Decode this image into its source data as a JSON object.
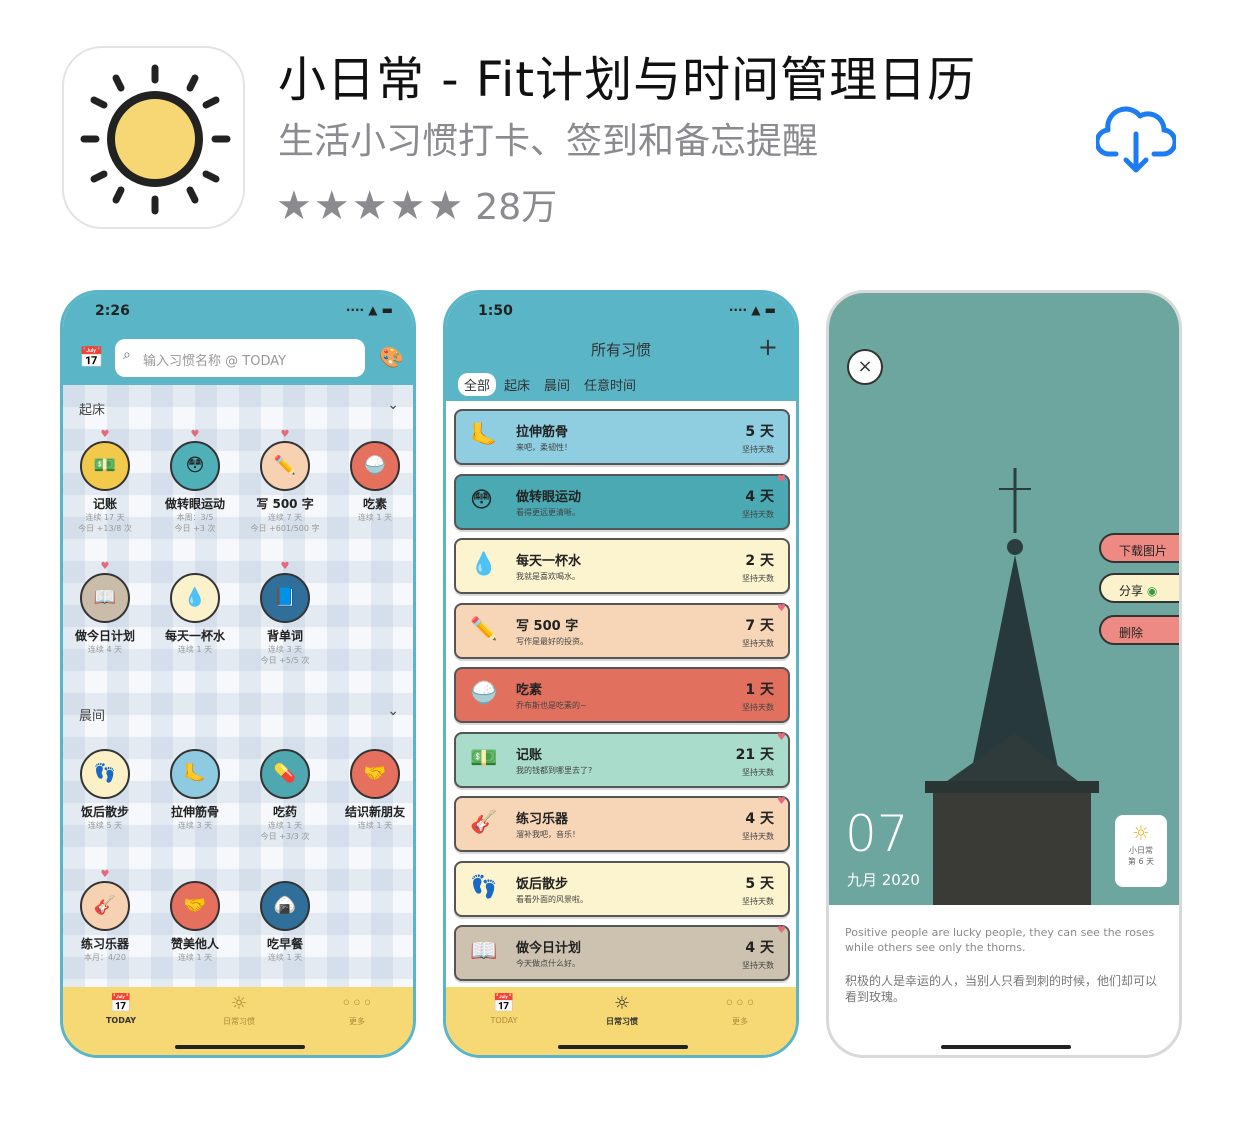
{
  "app": {
    "title": "小日常 - Fit计划与时间管理日历",
    "subtitle": "生活小习惯打卡、签到和备忘提醒",
    "stars": "★★★★★",
    "rating_count": "28万"
  },
  "screen1": {
    "time": "2:26",
    "status_icons": "···· ▲ ▬",
    "search_placeholder": "输入习惯名称 @ TODAY",
    "section1": "起床",
    "section2": "晨间",
    "habits": [
      {
        "name": "记账",
        "line1": "连续 17 天",
        "line2": "今日 +13/8 次",
        "icon": "💵",
        "color": "#f3c94c"
      },
      {
        "name": "做转眼运动",
        "line1": "本周：3/5",
        "line2": "今日 +3 次",
        "icon": "😳",
        "color": "#4fb0b8"
      },
      {
        "name": "写 500 字",
        "line1": "连续 7 天",
        "line2": "今日 +601/500 字",
        "icon": "✏️",
        "color": "#f6d1b2"
      },
      {
        "name": "吃素",
        "line1": "连续 1 天",
        "line2": "",
        "icon": "🍚",
        "color": "#e6705e"
      },
      {
        "name": "做今日计划",
        "line1": "连续 4 天",
        "line2": "",
        "icon": "📖",
        "color": "#c9bca8"
      },
      {
        "name": "每天一杯水",
        "line1": "连续 1 天",
        "line2": "",
        "icon": "💧",
        "color": "#fbf2cc"
      },
      {
        "name": "背单词",
        "line1": "连续 3 天",
        "line2": "今日 +5/5 次",
        "icon": "📘",
        "color": "#2f6f9a"
      },
      {
        "name": "饭后散步",
        "line1": "连续 5 天",
        "line2": "",
        "icon": "👣",
        "color": "#fbf0c6"
      },
      {
        "name": "拉伸筋骨",
        "line1": "连续 3 天",
        "line2": "",
        "icon": "🦶",
        "color": "#8fcbe0"
      },
      {
        "name": "吃药",
        "line1": "连续 1 天",
        "line2": "今日 +3/3 次",
        "icon": "💊",
        "color": "#4fa7b0"
      },
      {
        "name": "结识新朋友",
        "line1": "连续 1 天",
        "line2": "",
        "icon": "🤝",
        "color": "#e6705e"
      },
      {
        "name": "练习乐器",
        "line1": "本月：4/20",
        "line2": "",
        "icon": "🎸",
        "color": "#f6d1b2"
      },
      {
        "name": "赞美他人",
        "line1": "连续 1 天",
        "line2": "",
        "icon": "🤝",
        "color": "#e6705e"
      },
      {
        "name": "吃早餐",
        "line1": "连续 1 天",
        "line2": "",
        "icon": "🍙",
        "color": "#2f6f9a"
      }
    ],
    "tabs": [
      "TODAY",
      "日常习惯",
      "更多"
    ]
  },
  "screen2": {
    "time": "1:50",
    "status_icons": "···· ▲ ▬",
    "title": "所有习惯",
    "plus": "+",
    "chips": [
      "全部",
      "起床",
      "晨间",
      "任意时间"
    ],
    "cards": [
      {
        "name": "拉伸筋骨",
        "sub": "来吧，柔韧性！",
        "days": "5 天",
        "label": "坚持天数",
        "icon": "🦶",
        "color": "#8fcde0",
        "heart": ""
      },
      {
        "name": "做转眼运动",
        "sub": "看得更远更清晰。",
        "days": "4 天",
        "label": "坚持天数",
        "icon": "😳",
        "color": "#4aa9b2",
        "heart": "♥"
      },
      {
        "name": "每天一杯水",
        "sub": "我就是喜欢喝水。",
        "days": "2 天",
        "label": "坚持天数",
        "icon": "💧",
        "color": "#fcf3cf",
        "heart": ""
      },
      {
        "name": "写 500 字",
        "sub": "写作是最好的投资。",
        "days": "7 天",
        "label": "坚持天数",
        "icon": "✏️",
        "color": "#f7d6b8",
        "heart": "♥"
      },
      {
        "name": "吃素",
        "sub": "乔布斯也是吃素的~",
        "days": "1 天",
        "label": "坚持天数",
        "icon": "🍚",
        "color": "#e2705f",
        "heart": ""
      },
      {
        "name": "记账",
        "sub": "我的钱都到哪里去了?",
        "days": "21 天",
        "label": "坚持天数",
        "icon": "💵",
        "color": "#a9dccb",
        "heart": "♥"
      },
      {
        "name": "练习乐器",
        "sub": "溜补我吧，音乐！",
        "days": "4 天",
        "label": "坚持天数",
        "icon": "🎸",
        "color": "#f7d6b8",
        "heart": "♥"
      },
      {
        "name": "饭后散步",
        "sub": "看看外面的风景啦。",
        "days": "5 天",
        "label": "坚持天数",
        "icon": "👣",
        "color": "#fcf3cf",
        "heart": ""
      },
      {
        "name": "做今日计划",
        "sub": "今天做点什么好。",
        "days": "4 天",
        "label": "坚持天数",
        "icon": "📖",
        "color": "#cdc2b0",
        "heart": "♥"
      }
    ],
    "tabs": [
      "TODAY",
      "日常习惯",
      "更多"
    ]
  },
  "screen3": {
    "close": "×",
    "actions": [
      "下载图片",
      "分享",
      "删除"
    ],
    "day": "07",
    "month": "九月 2020",
    "badge_name": "小日常",
    "badge_sub": "第 6 天",
    "quote_en": "Positive people are lucky people, they can see the roses while others see only the thorns.",
    "quote_cn": "积极的人是幸运的人，当别人只看到刺的时候，他们却可以看到玫瑰。"
  }
}
